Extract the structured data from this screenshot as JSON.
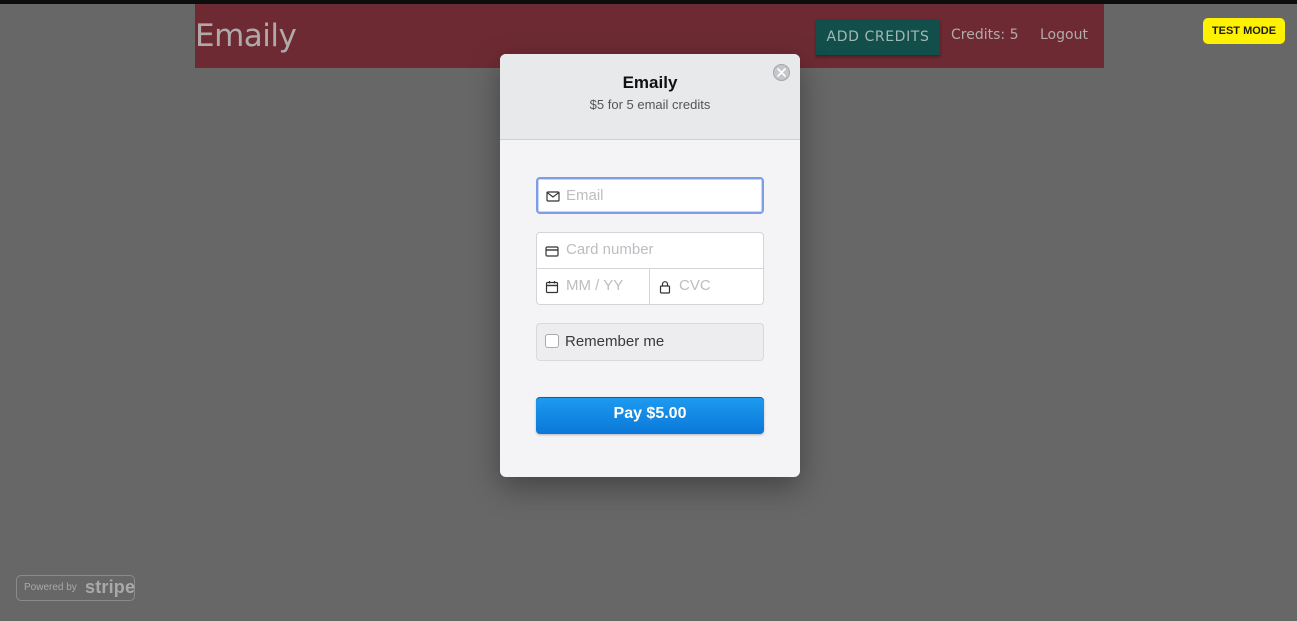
{
  "app": {
    "brand": "Emaily",
    "add_credits_label": "ADD CREDITS",
    "credits_text": "Credits: 5",
    "logout_label": "Logout"
  },
  "test_mode_badge": "TEST MODE",
  "checkout": {
    "title": "Emaily",
    "subtitle": "$5 for 5 email credits",
    "email_placeholder": "Email",
    "card_number_placeholder": "Card number",
    "expiry_placeholder": "MM / YY",
    "cvc_placeholder": "CVC",
    "remember_label": "Remember me",
    "pay_label": "Pay $5.00"
  },
  "footer": {
    "powered_by": "Powered by",
    "stripe": "stripe"
  },
  "colors": {
    "overlay": "#676767",
    "pay_button": "#0a78d8",
    "test_mode": "#fff200",
    "focus_border": "#7d9de6"
  }
}
